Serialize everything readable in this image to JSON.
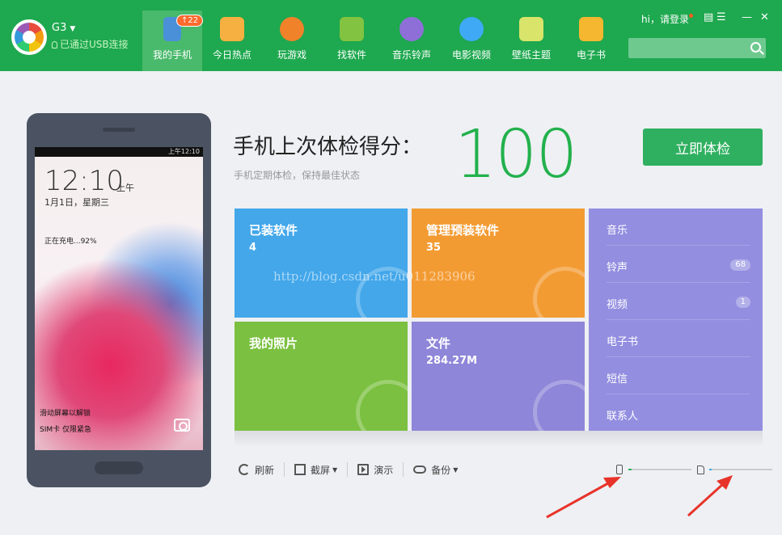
{
  "header": {
    "device_name": "G3",
    "connection_status": "已通过USB连接",
    "user_greeting": "hi，请登录",
    "nav": [
      {
        "label": "我的手机",
        "badge": "↑22",
        "icon": "phone-icon"
      },
      {
        "label": "今日热点",
        "icon": "star-icon"
      },
      {
        "label": "玩游戏",
        "icon": "gamepad-icon"
      },
      {
        "label": "找软件",
        "icon": "android-icon"
      },
      {
        "label": "音乐铃声",
        "icon": "music-icon"
      },
      {
        "label": "电影视频",
        "icon": "play-icon"
      },
      {
        "label": "壁纸主题",
        "icon": "wallpaper-icon"
      },
      {
        "label": "电子书",
        "icon": "book-icon"
      }
    ],
    "search_placeholder": ""
  },
  "phone_screen": {
    "status_time": "上午12:10",
    "clock": "12:10",
    "ampm": "上午",
    "date": "1月1日，星期三",
    "charging": "正在充电...92%",
    "unlock_hint": "滑动屏幕以解锁",
    "sim_status": "SIM卡 仅限紧急"
  },
  "score": {
    "title": "手机上次体检得分：",
    "subtitle": "手机定期体检，保持最佳状态",
    "value": "100",
    "check_button": "立即体检"
  },
  "tiles": {
    "installed": {
      "title": "已装软件",
      "value": "4"
    },
    "preinstalled": {
      "title": "管理预装软件",
      "value": "35"
    },
    "photos": {
      "title": "我的照片",
      "value": ""
    },
    "files": {
      "title": "文件",
      "value": "284.27M"
    }
  },
  "media_list": [
    {
      "label": "音乐",
      "count": ""
    },
    {
      "label": "铃声",
      "count": "68"
    },
    {
      "label": "视频",
      "count": "1"
    },
    {
      "label": "电子书",
      "count": ""
    },
    {
      "label": "短信",
      "count": ""
    },
    {
      "label": "联系人",
      "count": ""
    }
  ],
  "toolbar": {
    "refresh": "刷新",
    "screenshot": "截屏",
    "present": "演示",
    "backup": "备份"
  },
  "storage": {
    "phone_fill": 0.05,
    "sd_fill": 0.04
  },
  "watermark": "http://blog.csdn.net/u011283906",
  "colors": {
    "header_green": "#1ea84f",
    "score_green": "#22b14c",
    "tile_blue": "#43a7ea",
    "tile_orange": "#f39b33",
    "tile_green": "#7bc041",
    "tile_purple": "#8e86d8",
    "arrow_red": "#e8332a"
  }
}
